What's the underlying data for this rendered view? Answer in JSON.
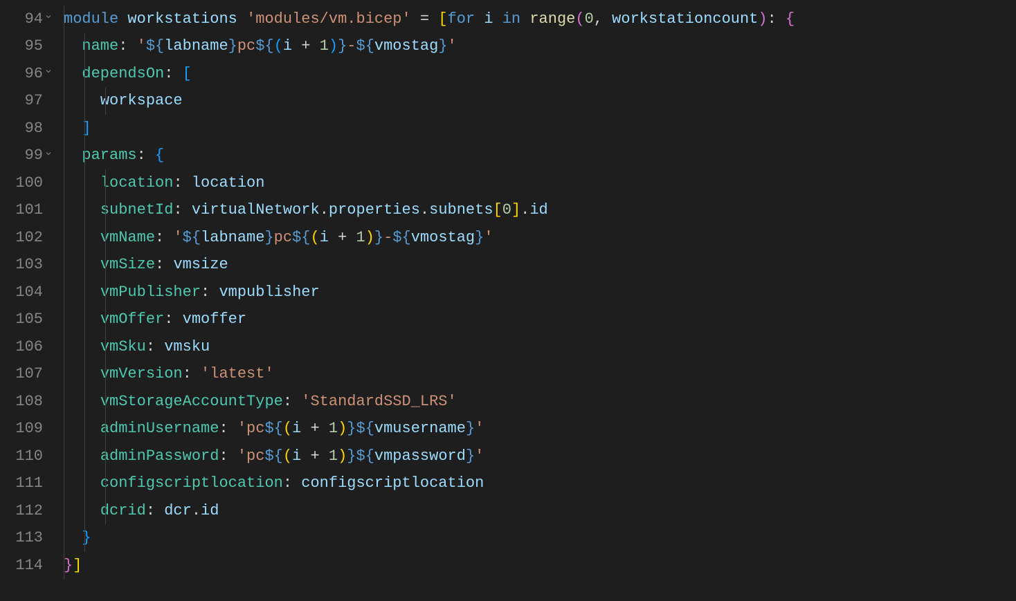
{
  "lines": [
    {
      "num": "94",
      "fold": true,
      "indent": 0,
      "tokens": [
        {
          "t": "module ",
          "c": "tok-keyword"
        },
        {
          "t": "workstations ",
          "c": "tok-ident"
        },
        {
          "t": "'modules/vm.bicep'",
          "c": "tok-string"
        },
        {
          "t": " = ",
          "c": "tok-white"
        },
        {
          "t": "[",
          "c": "tok-paren-y"
        },
        {
          "t": "for ",
          "c": "tok-keyword"
        },
        {
          "t": "i ",
          "c": "tok-ident"
        },
        {
          "t": "in ",
          "c": "tok-keyword"
        },
        {
          "t": "range",
          "c": "tok-func"
        },
        {
          "t": "(",
          "c": "tok-paren-p"
        },
        {
          "t": "0",
          "c": "tok-number"
        },
        {
          "t": ", ",
          "c": "tok-white"
        },
        {
          "t": "workstationcount",
          "c": "tok-ident"
        },
        {
          "t": ")",
          "c": "tok-paren-p"
        },
        {
          "t": ": ",
          "c": "tok-white"
        },
        {
          "t": "{",
          "c": "tok-paren-p"
        }
      ]
    },
    {
      "num": "95",
      "fold": false,
      "indent": 1,
      "tokens": [
        {
          "t": "  ",
          "c": ""
        },
        {
          "t": "name",
          "c": "tok-prop"
        },
        {
          "t": ": ",
          "c": "tok-white"
        },
        {
          "t": "'",
          "c": "tok-string"
        },
        {
          "t": "${",
          "c": "tok-interp"
        },
        {
          "t": "labname",
          "c": "tok-var"
        },
        {
          "t": "}",
          "c": "tok-interp"
        },
        {
          "t": "pc",
          "c": "tok-string"
        },
        {
          "t": "${",
          "c": "tok-interp"
        },
        {
          "t": "(",
          "c": "tok-paren-b"
        },
        {
          "t": "i ",
          "c": "tok-var"
        },
        {
          "t": "+ ",
          "c": "tok-white"
        },
        {
          "t": "1",
          "c": "tok-number"
        },
        {
          "t": ")",
          "c": "tok-paren-b"
        },
        {
          "t": "}",
          "c": "tok-interp"
        },
        {
          "t": "-",
          "c": "tok-string"
        },
        {
          "t": "${",
          "c": "tok-interp"
        },
        {
          "t": "vmostag",
          "c": "tok-var"
        },
        {
          "t": "}",
          "c": "tok-interp"
        },
        {
          "t": "'",
          "c": "tok-string"
        }
      ]
    },
    {
      "num": "96",
      "fold": true,
      "indent": 1,
      "tokens": [
        {
          "t": "  ",
          "c": ""
        },
        {
          "t": "dependsOn",
          "c": "tok-prop"
        },
        {
          "t": ": ",
          "c": "tok-white"
        },
        {
          "t": "[",
          "c": "tok-paren-b"
        }
      ]
    },
    {
      "num": "97",
      "fold": false,
      "indent": 2,
      "tokens": [
        {
          "t": "    ",
          "c": ""
        },
        {
          "t": "workspace",
          "c": "tok-ident"
        }
      ]
    },
    {
      "num": "98",
      "fold": false,
      "indent": 1,
      "tokens": [
        {
          "t": "  ",
          "c": ""
        },
        {
          "t": "]",
          "c": "tok-paren-b"
        }
      ]
    },
    {
      "num": "99",
      "fold": true,
      "indent": 1,
      "tokens": [
        {
          "t": "  ",
          "c": ""
        },
        {
          "t": "params",
          "c": "tok-prop"
        },
        {
          "t": ": ",
          "c": "tok-white"
        },
        {
          "t": "{",
          "c": "tok-paren-b"
        }
      ]
    },
    {
      "num": "100",
      "fold": false,
      "indent": 2,
      "tokens": [
        {
          "t": "    ",
          "c": ""
        },
        {
          "t": "location",
          "c": "tok-prop"
        },
        {
          "t": ": ",
          "c": "tok-white"
        },
        {
          "t": "location",
          "c": "tok-ident"
        }
      ]
    },
    {
      "num": "101",
      "fold": false,
      "indent": 2,
      "tokens": [
        {
          "t": "    ",
          "c": ""
        },
        {
          "t": "subnetId",
          "c": "tok-prop"
        },
        {
          "t": ": ",
          "c": "tok-white"
        },
        {
          "t": "virtualNetwork",
          "c": "tok-ident"
        },
        {
          "t": ".",
          "c": "tok-white"
        },
        {
          "t": "properties",
          "c": "tok-ident"
        },
        {
          "t": ".",
          "c": "tok-white"
        },
        {
          "t": "subnets",
          "c": "tok-ident"
        },
        {
          "t": "[",
          "c": "tok-paren-y"
        },
        {
          "t": "0",
          "c": "tok-number"
        },
        {
          "t": "]",
          "c": "tok-paren-y"
        },
        {
          "t": ".",
          "c": "tok-white"
        },
        {
          "t": "id",
          "c": "tok-ident"
        }
      ]
    },
    {
      "num": "102",
      "fold": false,
      "indent": 2,
      "tokens": [
        {
          "t": "    ",
          "c": ""
        },
        {
          "t": "vmName",
          "c": "tok-prop"
        },
        {
          "t": ": ",
          "c": "tok-white"
        },
        {
          "t": "'",
          "c": "tok-string"
        },
        {
          "t": "${",
          "c": "tok-interp"
        },
        {
          "t": "labname",
          "c": "tok-var"
        },
        {
          "t": "}",
          "c": "tok-interp"
        },
        {
          "t": "pc",
          "c": "tok-string"
        },
        {
          "t": "${",
          "c": "tok-interp"
        },
        {
          "t": "(",
          "c": "tok-paren-y"
        },
        {
          "t": "i ",
          "c": "tok-var"
        },
        {
          "t": "+ ",
          "c": "tok-white"
        },
        {
          "t": "1",
          "c": "tok-number"
        },
        {
          "t": ")",
          "c": "tok-paren-y"
        },
        {
          "t": "}",
          "c": "tok-interp"
        },
        {
          "t": "-",
          "c": "tok-string"
        },
        {
          "t": "${",
          "c": "tok-interp"
        },
        {
          "t": "vmostag",
          "c": "tok-var"
        },
        {
          "t": "}",
          "c": "tok-interp"
        },
        {
          "t": "'",
          "c": "tok-string"
        }
      ]
    },
    {
      "num": "103",
      "fold": false,
      "indent": 2,
      "tokens": [
        {
          "t": "    ",
          "c": ""
        },
        {
          "t": "vmSize",
          "c": "tok-prop"
        },
        {
          "t": ": ",
          "c": "tok-white"
        },
        {
          "t": "vmsize",
          "c": "tok-ident"
        }
      ]
    },
    {
      "num": "104",
      "fold": false,
      "indent": 2,
      "tokens": [
        {
          "t": "    ",
          "c": ""
        },
        {
          "t": "vmPublisher",
          "c": "tok-prop"
        },
        {
          "t": ": ",
          "c": "tok-white"
        },
        {
          "t": "vmpublisher",
          "c": "tok-ident"
        }
      ]
    },
    {
      "num": "105",
      "fold": false,
      "indent": 2,
      "tokens": [
        {
          "t": "    ",
          "c": ""
        },
        {
          "t": "vmOffer",
          "c": "tok-prop"
        },
        {
          "t": ": ",
          "c": "tok-white"
        },
        {
          "t": "vmoffer",
          "c": "tok-ident"
        }
      ]
    },
    {
      "num": "106",
      "fold": false,
      "indent": 2,
      "tokens": [
        {
          "t": "    ",
          "c": ""
        },
        {
          "t": "vmSku",
          "c": "tok-prop"
        },
        {
          "t": ": ",
          "c": "tok-white"
        },
        {
          "t": "vmsku",
          "c": "tok-ident"
        }
      ]
    },
    {
      "num": "107",
      "fold": false,
      "indent": 2,
      "tokens": [
        {
          "t": "    ",
          "c": ""
        },
        {
          "t": "vmVersion",
          "c": "tok-prop"
        },
        {
          "t": ": ",
          "c": "tok-white"
        },
        {
          "t": "'latest'",
          "c": "tok-string"
        }
      ]
    },
    {
      "num": "108",
      "fold": false,
      "indent": 2,
      "tokens": [
        {
          "t": "    ",
          "c": ""
        },
        {
          "t": "vmStorageAccountType",
          "c": "tok-prop"
        },
        {
          "t": ": ",
          "c": "tok-white"
        },
        {
          "t": "'StandardSSD_LRS'",
          "c": "tok-string"
        }
      ]
    },
    {
      "num": "109",
      "fold": false,
      "indent": 2,
      "tokens": [
        {
          "t": "    ",
          "c": ""
        },
        {
          "t": "adminUsername",
          "c": "tok-prop"
        },
        {
          "t": ": ",
          "c": "tok-white"
        },
        {
          "t": "'pc",
          "c": "tok-string"
        },
        {
          "t": "${",
          "c": "tok-interp"
        },
        {
          "t": "(",
          "c": "tok-paren-y"
        },
        {
          "t": "i ",
          "c": "tok-var"
        },
        {
          "t": "+ ",
          "c": "tok-white"
        },
        {
          "t": "1",
          "c": "tok-number"
        },
        {
          "t": ")",
          "c": "tok-paren-y"
        },
        {
          "t": "}",
          "c": "tok-interp"
        },
        {
          "t": "${",
          "c": "tok-interp"
        },
        {
          "t": "vmusername",
          "c": "tok-var"
        },
        {
          "t": "}",
          "c": "tok-interp"
        },
        {
          "t": "'",
          "c": "tok-string"
        }
      ]
    },
    {
      "num": "110",
      "fold": false,
      "indent": 2,
      "tokens": [
        {
          "t": "    ",
          "c": ""
        },
        {
          "t": "adminPassword",
          "c": "tok-prop"
        },
        {
          "t": ": ",
          "c": "tok-white"
        },
        {
          "t": "'pc",
          "c": "tok-string"
        },
        {
          "t": "${",
          "c": "tok-interp"
        },
        {
          "t": "(",
          "c": "tok-paren-y"
        },
        {
          "t": "i ",
          "c": "tok-var"
        },
        {
          "t": "+ ",
          "c": "tok-white"
        },
        {
          "t": "1",
          "c": "tok-number"
        },
        {
          "t": ")",
          "c": "tok-paren-y"
        },
        {
          "t": "}",
          "c": "tok-interp"
        },
        {
          "t": "${",
          "c": "tok-interp"
        },
        {
          "t": "vmpassword",
          "c": "tok-var"
        },
        {
          "t": "}",
          "c": "tok-interp"
        },
        {
          "t": "'",
          "c": "tok-string"
        }
      ]
    },
    {
      "num": "111",
      "fold": false,
      "indent": 2,
      "tokens": [
        {
          "t": "    ",
          "c": ""
        },
        {
          "t": "configscriptlocation",
          "c": "tok-prop"
        },
        {
          "t": ": ",
          "c": "tok-white"
        },
        {
          "t": "configscriptlocation",
          "c": "tok-ident"
        }
      ]
    },
    {
      "num": "112",
      "fold": false,
      "indent": 2,
      "tokens": [
        {
          "t": "    ",
          "c": ""
        },
        {
          "t": "dcrid",
          "c": "tok-prop"
        },
        {
          "t": ": ",
          "c": "tok-white"
        },
        {
          "t": "dcr",
          "c": "tok-ident"
        },
        {
          "t": ".",
          "c": "tok-white"
        },
        {
          "t": "id",
          "c": "tok-ident"
        }
      ]
    },
    {
      "num": "113",
      "fold": false,
      "indent": 1,
      "tokens": [
        {
          "t": "  ",
          "c": ""
        },
        {
          "t": "}",
          "c": "tok-paren-b"
        }
      ]
    },
    {
      "num": "114",
      "fold": false,
      "indent": 0,
      "tokens": [
        {
          "t": "}",
          "c": "tok-paren-p"
        },
        {
          "t": "]",
          "c": "tok-paren-y"
        }
      ]
    }
  ]
}
